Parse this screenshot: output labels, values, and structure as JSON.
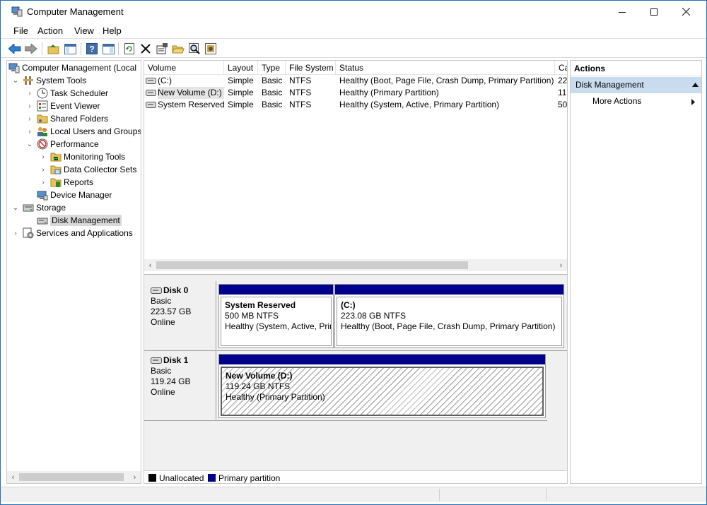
{
  "window": {
    "title": "Computer Management",
    "minimize_glyph": "–",
    "maximize_glyph": "□",
    "close_glyph": "✕"
  },
  "menu": [
    "File",
    "Action",
    "View",
    "Help"
  ],
  "toolbar_icons": [
    "back-arrow-icon",
    "forward-arrow-icon",
    "up-folder-icon",
    "show-hide-tree-icon",
    "help-icon",
    "show-hide-action-pane-icon",
    "refresh-icon",
    "delete-icon",
    "properties-icon",
    "open-folder-icon",
    "search-icon",
    "disk-properties-icon"
  ],
  "tree": {
    "root": "Computer Management (Local",
    "system_tools": "System Tools",
    "task_scheduler": "Task Scheduler",
    "event_viewer": "Event Viewer",
    "shared_folders": "Shared Folders",
    "local_users": "Local Users and Groups",
    "performance": "Performance",
    "monitoring_tools": "Monitoring Tools",
    "data_collector_sets": "Data Collector Sets",
    "reports": "Reports",
    "device_manager": "Device Manager",
    "storage": "Storage",
    "disk_management": "Disk Management",
    "services_apps": "Services and Applications"
  },
  "volume_list": {
    "columns": [
      "Volume",
      "Layout",
      "Type",
      "File System",
      "Status",
      "Ca"
    ],
    "rows": [
      {
        "volume": " (C:)",
        "layout": "Simple",
        "type": "Basic",
        "fs": "NTFS",
        "status": "Healthy (Boot, Page File, Crash Dump, Primary Partition)",
        "cap": "22"
      },
      {
        "volume": "New Volume (D:)",
        "layout": "Simple",
        "type": "Basic",
        "fs": "NTFS",
        "status": "Healthy (Primary Partition)",
        "cap": "11"
      },
      {
        "volume": "System Reserved",
        "layout": "Simple",
        "type": "Basic",
        "fs": "NTFS",
        "status": "Healthy (System, Active, Primary Partition)",
        "cap": "50"
      }
    ]
  },
  "disks": [
    {
      "name": "Disk 0",
      "type": "Basic",
      "size": "223.57 GB",
      "state": "Online",
      "partitions": [
        {
          "name": "System Reserved",
          "size": "500 MB NTFS",
          "status": "Healthy (System, Active, Primary Partition)"
        },
        {
          "name": " (C:)",
          "size": "223.08 GB NTFS",
          "status": "Healthy (Boot, Page File, Crash Dump, Primary Partition)"
        }
      ]
    },
    {
      "name": "Disk 1",
      "type": "Basic",
      "size": "119.24 GB",
      "state": "Online",
      "partitions": [
        {
          "name": "New Volume  (D:)",
          "size": "119.24 GB NTFS",
          "status": "Healthy (Primary Partition)"
        }
      ]
    }
  ],
  "legend": {
    "unallocated": "Unallocated",
    "primary": "Primary partition",
    "unallocated_color": "#000000",
    "primary_color": "#00008b"
  },
  "actions": {
    "header": "Actions",
    "section": "Disk Management",
    "more": "More Actions"
  },
  "colors": {
    "selection": "#c9dcef",
    "partition_bar": "#00008b",
    "window_border": "#1e6fb5"
  }
}
